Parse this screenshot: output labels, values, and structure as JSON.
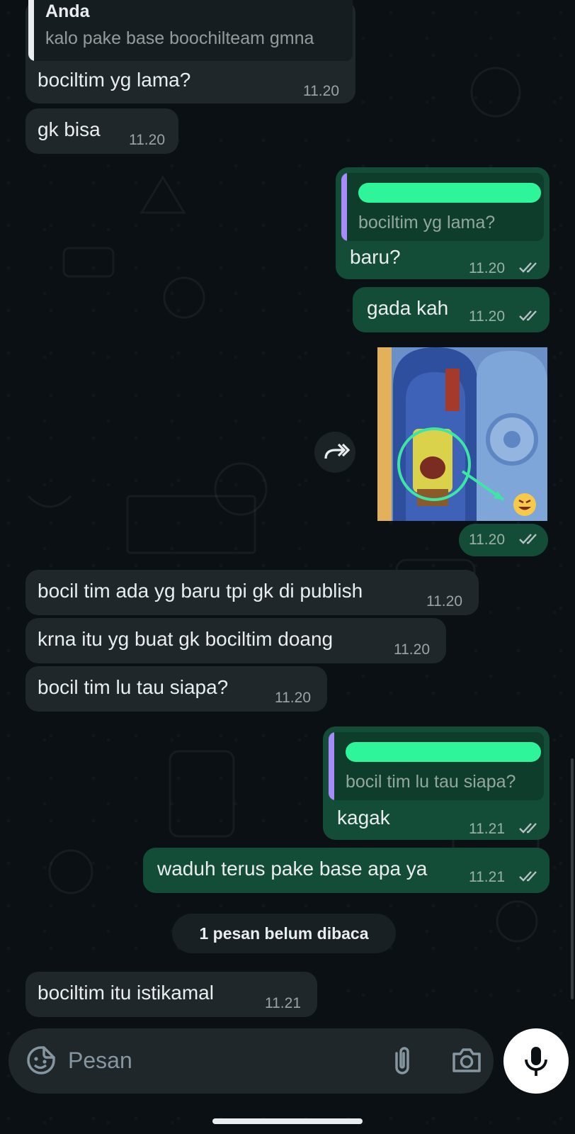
{
  "messages": [
    {
      "id": "m1",
      "quote": {
        "author": "Anda",
        "text": "kalo pake base boochilteam gmna"
      },
      "text": "bociltim yg lama?",
      "time": "11.20"
    },
    {
      "id": "m2",
      "text": "gk bisa",
      "time": "11.20"
    },
    {
      "id": "m3",
      "quote": {
        "text": "bociltim yg lama?"
      },
      "text": "baru?",
      "time": "11.20",
      "status": "read"
    },
    {
      "id": "m4",
      "text": "gada kah",
      "time": "11.20",
      "status": "read"
    },
    {
      "id": "m5",
      "sticker": "spongebob-laughing-sticker",
      "time": "11.20",
      "status": "read"
    },
    {
      "id": "m6",
      "text": "bocil tim ada yg baru tpi gk di publish",
      "time": "11.20"
    },
    {
      "id": "m7",
      "text": "krna itu yg buat gk bociltim doang",
      "time": "11.20"
    },
    {
      "id": "m8",
      "text": "bocil tim lu tau siapa?",
      "time": "11.20"
    },
    {
      "id": "m9",
      "quote": {
        "text": "bocil tim lu tau siapa?"
      },
      "text": "kagak",
      "time": "11.21",
      "status": "read"
    },
    {
      "id": "m10",
      "text": "waduh terus pake base apa ya",
      "time": "11.21",
      "status": "read"
    },
    {
      "id": "m11",
      "text": "bociltim itu istikamal",
      "time": "11.21"
    }
  ],
  "unread_banner": "1 pesan belum dibaca",
  "composer": {
    "placeholder": "Pesan"
  },
  "icons": {
    "emoji": "sticker-emoji-icon",
    "attach": "paperclip-icon",
    "camera": "camera-icon",
    "mic": "microphone-icon",
    "forward": "forward-icon",
    "read": "double-check-icon"
  },
  "colors": {
    "incoming_bubble": "#1f272a",
    "outgoing_bubble": "#144d37",
    "background": "#0b1014",
    "quote_bar_in": "#ffffff",
    "quote_bar_out": "#a78bfa",
    "read_ticks": "#b8c2c6"
  }
}
